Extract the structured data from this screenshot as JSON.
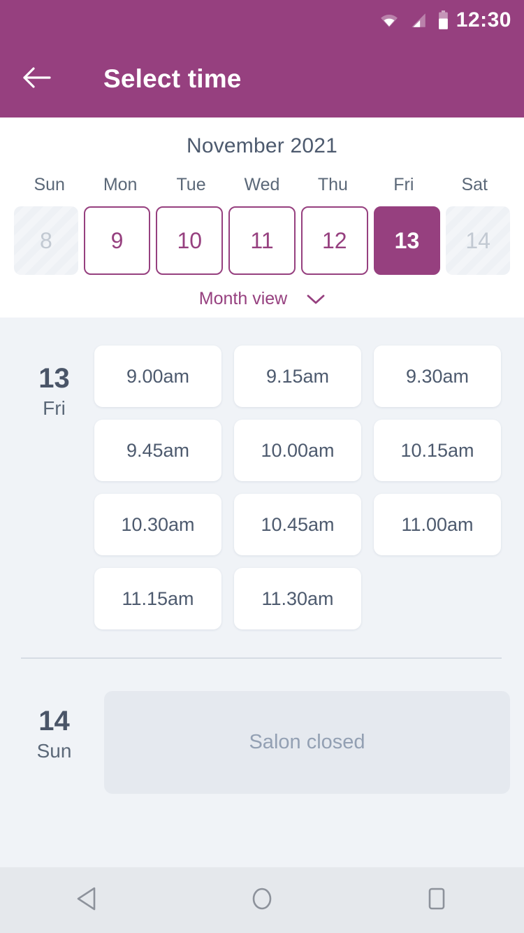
{
  "status_bar": {
    "time": "12:30",
    "icons": [
      "wifi-icon",
      "signal-icon",
      "battery-icon"
    ]
  },
  "app_bar": {
    "title": "Select time",
    "back_icon": "arrow-left-icon",
    "background_color": "#96407f"
  },
  "calendar": {
    "month_title": "November 2021",
    "weekdays": [
      "Sun",
      "Mon",
      "Tue",
      "Wed",
      "Thu",
      "Fri",
      "Sat"
    ],
    "days": [
      {
        "num": "8",
        "state": "disabled"
      },
      {
        "num": "9",
        "state": "available"
      },
      {
        "num": "10",
        "state": "available"
      },
      {
        "num": "11",
        "state": "available"
      },
      {
        "num": "12",
        "state": "available"
      },
      {
        "num": "13",
        "state": "selected"
      },
      {
        "num": "14",
        "state": "disabled"
      }
    ],
    "month_view_label": "Month view",
    "month_view_icon": "chevron-down-icon",
    "accent_color": "#96407f"
  },
  "schedule": [
    {
      "day_number": "13",
      "day_name": "Fri",
      "slots": [
        "9.00am",
        "9.15am",
        "9.30am",
        "9.45am",
        "10.00am",
        "10.15am",
        "10.30am",
        "10.45am",
        "11.00am",
        "11.15am",
        "11.30am"
      ],
      "closed_message": null
    },
    {
      "day_number": "14",
      "day_name": "Sun",
      "slots": [],
      "closed_message": "Salon closed"
    }
  ],
  "nav_bar": {
    "buttons": [
      {
        "name": "back-nav-icon",
        "icon": "triangle-left-icon"
      },
      {
        "name": "home-nav-icon",
        "icon": "circle-icon"
      },
      {
        "name": "recents-nav-icon",
        "icon": "square-icon"
      }
    ]
  }
}
